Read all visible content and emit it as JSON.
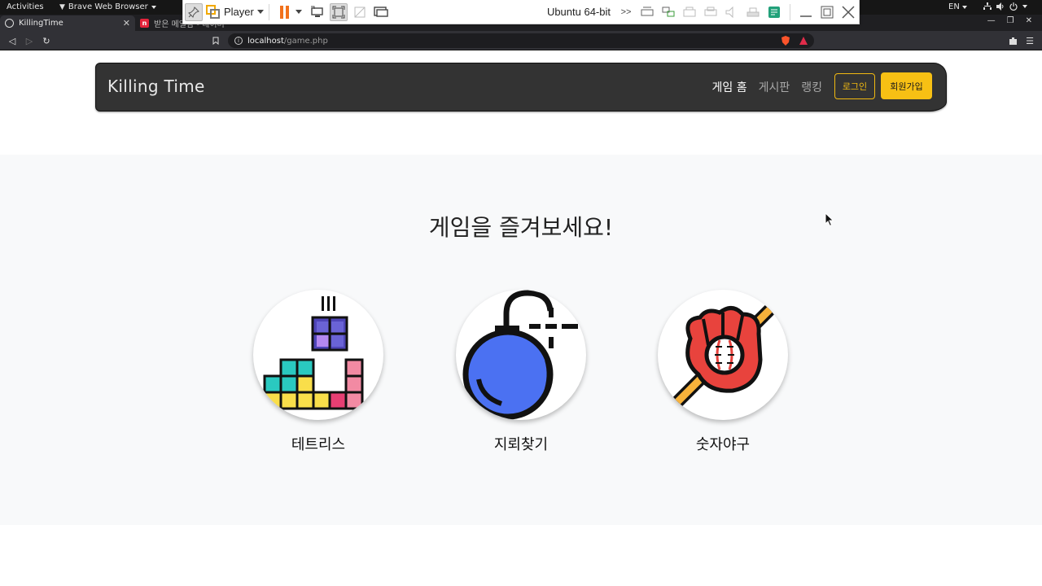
{
  "system_bar": {
    "activities": "Activities",
    "app_name": "Brave Web Browser",
    "lang": "EN"
  },
  "vm_toolbar": {
    "player_label": "Player",
    "vm_name": "Ubuntu 64-bit"
  },
  "browser": {
    "tabs": [
      {
        "title": "KillingTime",
        "active": true
      },
      {
        "title": "받은 메일함 - 네이버 메일",
        "active": false
      }
    ],
    "url_host": "localhost",
    "url_path": "/game.php"
  },
  "site": {
    "brand": "Killing Time",
    "nav": {
      "home": "게임 홈",
      "board": "게시판",
      "ranking": "랭킹"
    },
    "login_button": "로그인",
    "signup_button": "회원가입"
  },
  "hero": {
    "title": "게임을 즐겨보세요!"
  },
  "games": [
    {
      "label": "테트리스",
      "icon": "tetris-blocks-icon"
    },
    {
      "label": "지뢰찾기",
      "icon": "bomb-icon"
    },
    {
      "label": "숫자야구",
      "icon": "baseball-glove-icon"
    }
  ],
  "colors": {
    "navbar_bg": "#333333",
    "accent_yellow": "#f7c014",
    "section_bg": "#f8f9fa"
  }
}
